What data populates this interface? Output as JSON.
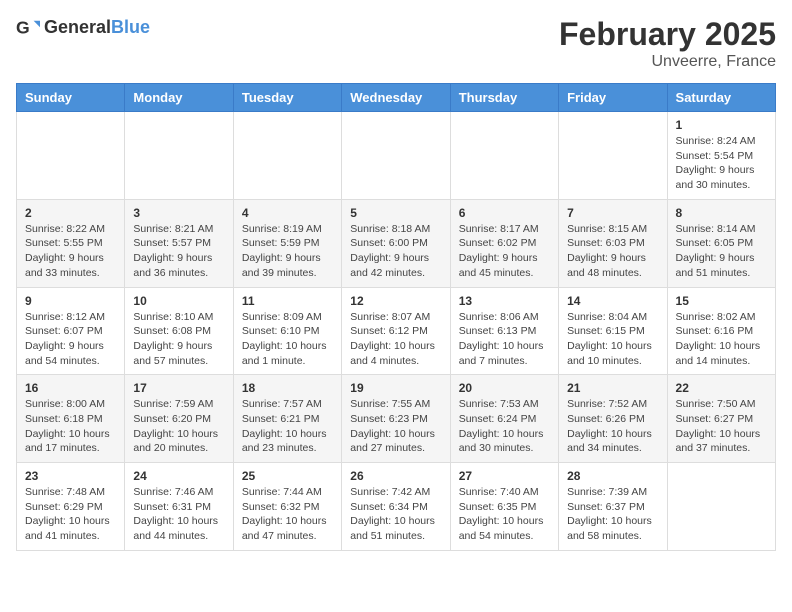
{
  "logo": {
    "general": "General",
    "blue": "Blue"
  },
  "title": {
    "month": "February 2025",
    "location": "Unveerre, France"
  },
  "weekdays": [
    "Sunday",
    "Monday",
    "Tuesday",
    "Wednesday",
    "Thursday",
    "Friday",
    "Saturday"
  ],
  "weeks": [
    [
      {
        "day": "",
        "info": ""
      },
      {
        "day": "",
        "info": ""
      },
      {
        "day": "",
        "info": ""
      },
      {
        "day": "",
        "info": ""
      },
      {
        "day": "",
        "info": ""
      },
      {
        "day": "",
        "info": ""
      },
      {
        "day": "1",
        "info": "Sunrise: 8:24 AM\nSunset: 5:54 PM\nDaylight: 9 hours and 30 minutes."
      }
    ],
    [
      {
        "day": "2",
        "info": "Sunrise: 8:22 AM\nSunset: 5:55 PM\nDaylight: 9 hours and 33 minutes."
      },
      {
        "day": "3",
        "info": "Sunrise: 8:21 AM\nSunset: 5:57 PM\nDaylight: 9 hours and 36 minutes."
      },
      {
        "day": "4",
        "info": "Sunrise: 8:19 AM\nSunset: 5:59 PM\nDaylight: 9 hours and 39 minutes."
      },
      {
        "day": "5",
        "info": "Sunrise: 8:18 AM\nSunset: 6:00 PM\nDaylight: 9 hours and 42 minutes."
      },
      {
        "day": "6",
        "info": "Sunrise: 8:17 AM\nSunset: 6:02 PM\nDaylight: 9 hours and 45 minutes."
      },
      {
        "day": "7",
        "info": "Sunrise: 8:15 AM\nSunset: 6:03 PM\nDaylight: 9 hours and 48 minutes."
      },
      {
        "day": "8",
        "info": "Sunrise: 8:14 AM\nSunset: 6:05 PM\nDaylight: 9 hours and 51 minutes."
      }
    ],
    [
      {
        "day": "9",
        "info": "Sunrise: 8:12 AM\nSunset: 6:07 PM\nDaylight: 9 hours and 54 minutes."
      },
      {
        "day": "10",
        "info": "Sunrise: 8:10 AM\nSunset: 6:08 PM\nDaylight: 9 hours and 57 minutes."
      },
      {
        "day": "11",
        "info": "Sunrise: 8:09 AM\nSunset: 6:10 PM\nDaylight: 10 hours and 1 minute."
      },
      {
        "day": "12",
        "info": "Sunrise: 8:07 AM\nSunset: 6:12 PM\nDaylight: 10 hours and 4 minutes."
      },
      {
        "day": "13",
        "info": "Sunrise: 8:06 AM\nSunset: 6:13 PM\nDaylight: 10 hours and 7 minutes."
      },
      {
        "day": "14",
        "info": "Sunrise: 8:04 AM\nSunset: 6:15 PM\nDaylight: 10 hours and 10 minutes."
      },
      {
        "day": "15",
        "info": "Sunrise: 8:02 AM\nSunset: 6:16 PM\nDaylight: 10 hours and 14 minutes."
      }
    ],
    [
      {
        "day": "16",
        "info": "Sunrise: 8:00 AM\nSunset: 6:18 PM\nDaylight: 10 hours and 17 minutes."
      },
      {
        "day": "17",
        "info": "Sunrise: 7:59 AM\nSunset: 6:20 PM\nDaylight: 10 hours and 20 minutes."
      },
      {
        "day": "18",
        "info": "Sunrise: 7:57 AM\nSunset: 6:21 PM\nDaylight: 10 hours and 23 minutes."
      },
      {
        "day": "19",
        "info": "Sunrise: 7:55 AM\nSunset: 6:23 PM\nDaylight: 10 hours and 27 minutes."
      },
      {
        "day": "20",
        "info": "Sunrise: 7:53 AM\nSunset: 6:24 PM\nDaylight: 10 hours and 30 minutes."
      },
      {
        "day": "21",
        "info": "Sunrise: 7:52 AM\nSunset: 6:26 PM\nDaylight: 10 hours and 34 minutes."
      },
      {
        "day": "22",
        "info": "Sunrise: 7:50 AM\nSunset: 6:27 PM\nDaylight: 10 hours and 37 minutes."
      }
    ],
    [
      {
        "day": "23",
        "info": "Sunrise: 7:48 AM\nSunset: 6:29 PM\nDaylight: 10 hours and 41 minutes."
      },
      {
        "day": "24",
        "info": "Sunrise: 7:46 AM\nSunset: 6:31 PM\nDaylight: 10 hours and 44 minutes."
      },
      {
        "day": "25",
        "info": "Sunrise: 7:44 AM\nSunset: 6:32 PM\nDaylight: 10 hours and 47 minutes."
      },
      {
        "day": "26",
        "info": "Sunrise: 7:42 AM\nSunset: 6:34 PM\nDaylight: 10 hours and 51 minutes."
      },
      {
        "day": "27",
        "info": "Sunrise: 7:40 AM\nSunset: 6:35 PM\nDaylight: 10 hours and 54 minutes."
      },
      {
        "day": "28",
        "info": "Sunrise: 7:39 AM\nSunset: 6:37 PM\nDaylight: 10 hours and 58 minutes."
      },
      {
        "day": "",
        "info": ""
      }
    ]
  ]
}
